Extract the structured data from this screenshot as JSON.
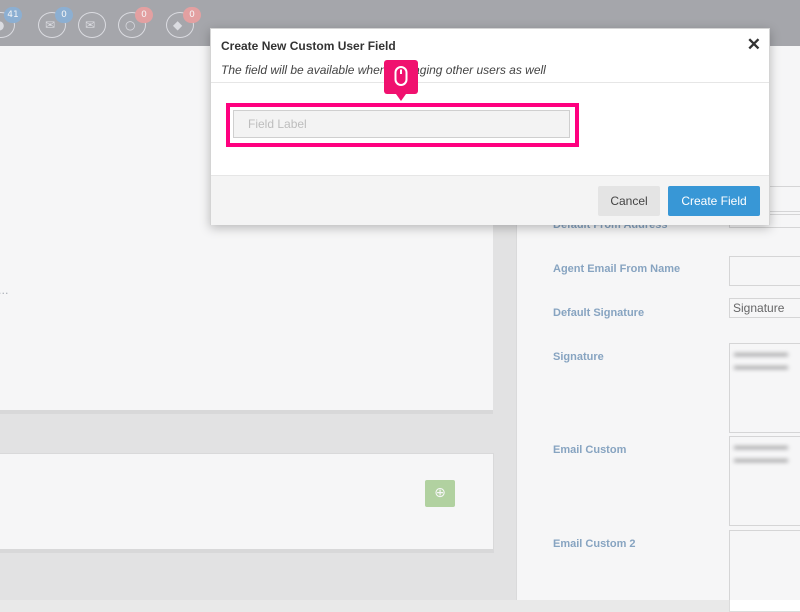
{
  "topbar": {
    "icons": [
      {
        "name": "chat-icon",
        "count": "41",
        "badge_color": "#8fb4d8"
      },
      {
        "name": "mail-icon",
        "count": "0",
        "badge_color": "#8fb4d8"
      },
      {
        "name": "open-mail-icon"
      },
      {
        "name": "comment-icon",
        "count": "0",
        "badge_color": "#eba4a4"
      },
      {
        "name": "tag-icon",
        "count": "0",
        "badge_color": "#eba4a4"
      }
    ]
  },
  "settings": {
    "default_from_address_label": "Default From Address",
    "agent_email_from_name_label": "Agent Email From Name",
    "default_signature_label": "Default Signature",
    "default_signature_value": "Signature",
    "signature_label": "Signature",
    "email_custom_label": "Email Custom",
    "email_custom_2_label": "Email Custom 2"
  },
  "modal": {
    "title": "Create New Custom User Field",
    "subtitle": "The field will be available when managing other users as well",
    "close_symbol": "✕",
    "field_placeholder": "Field Label",
    "cancel_label": "Cancel",
    "create_label": "Create Field",
    "highlight_color": "#ff007f",
    "primary_color": "#3897d6"
  }
}
